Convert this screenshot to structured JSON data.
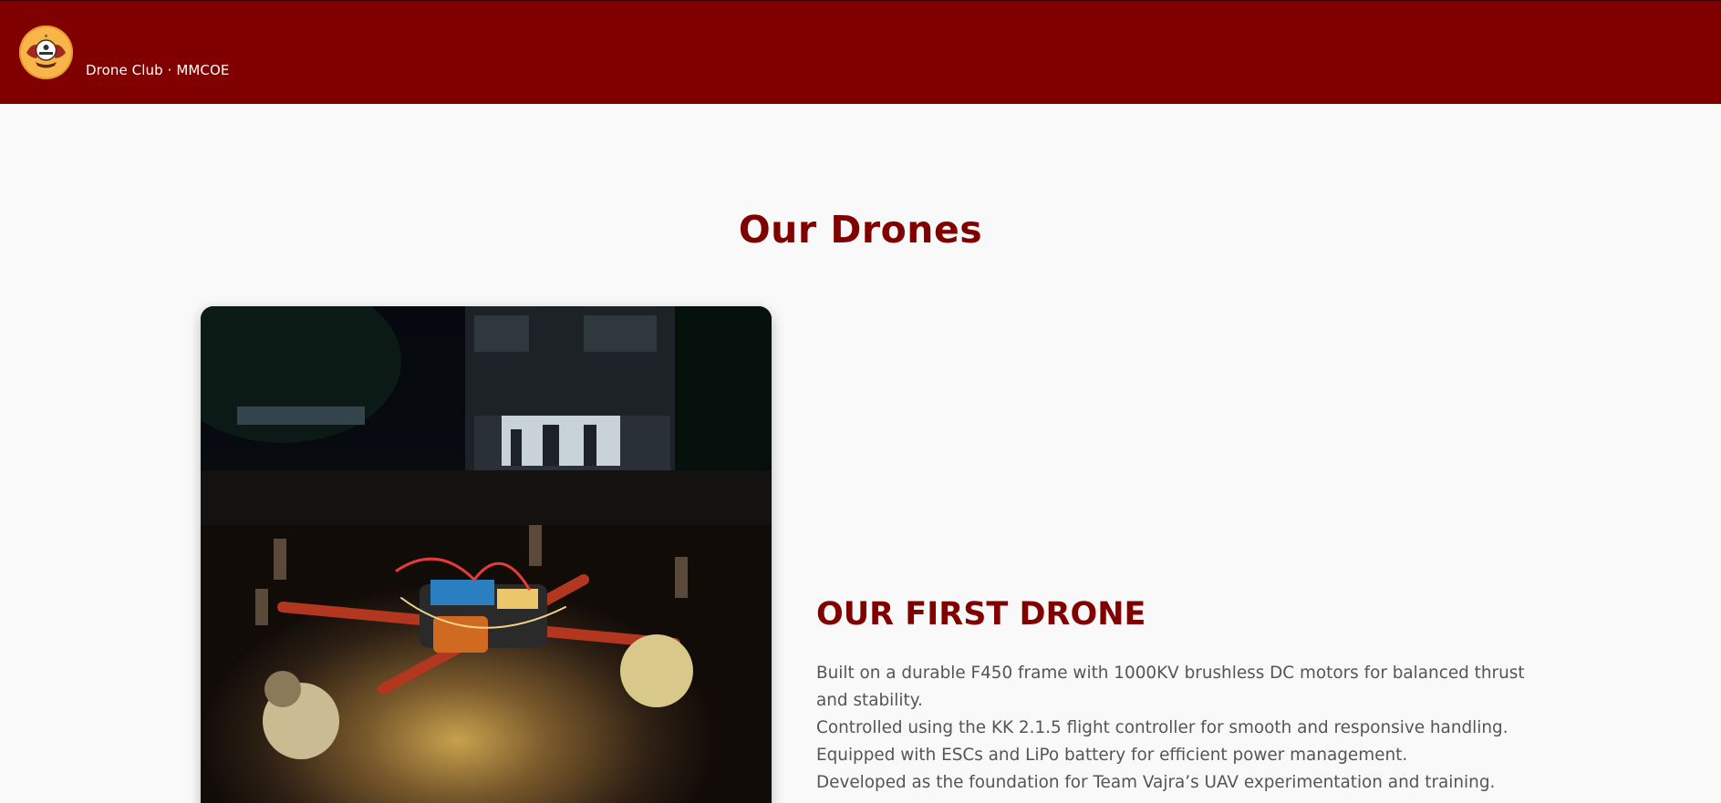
{
  "header": {
    "brand": "Drone Club · MMCOE",
    "logo_icon": "club-emblem-icon"
  },
  "main": {
    "section_title": "Our Drones",
    "drone": {
      "title": "OUR FIRST DRONE",
      "image_icon": "drone-photo",
      "description": [
        "Built on a durable F450 frame with 1000KV brushless DC motors for balanced thrust",
        "and stability.",
        "Controlled using the KK 2.1.5 flight controller for smooth and responsive handling.",
        "Equipped with ESCs and LiPo battery for efficient power management.",
        "Developed as the foundation for Team Vajra’s UAV experimentation and training."
      ]
    }
  },
  "colors": {
    "accent": "#800000",
    "background": "#f9f9f9",
    "text": "#555555",
    "logo_bg": "#f7b54a"
  }
}
